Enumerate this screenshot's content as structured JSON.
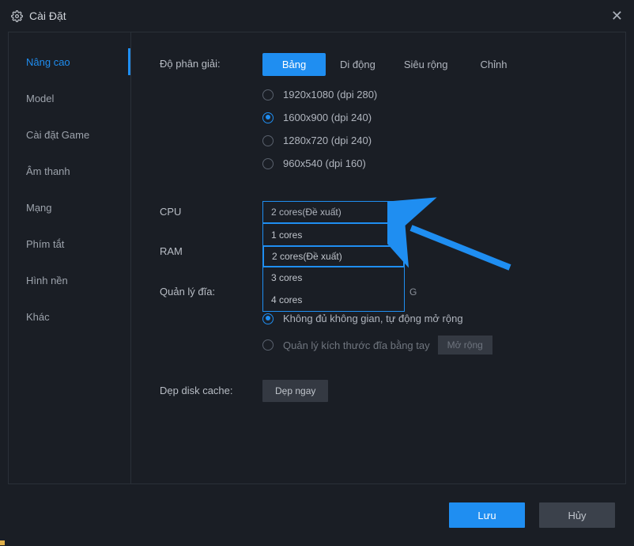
{
  "window": {
    "title": "Cài Đặt"
  },
  "sidebar": {
    "items": [
      {
        "label": "Nâng cao",
        "active": true
      },
      {
        "label": "Model",
        "active": false
      },
      {
        "label": "Cài đặt Game",
        "active": false
      },
      {
        "label": "Âm thanh",
        "active": false
      },
      {
        "label": "Mạng",
        "active": false
      },
      {
        "label": "Phím tắt",
        "active": false
      },
      {
        "label": "Hình nền",
        "active": false
      },
      {
        "label": "Khác",
        "active": false
      }
    ]
  },
  "resolution": {
    "label": "Độ phân giải:",
    "tabs": [
      {
        "label": "Bảng",
        "active": true
      },
      {
        "label": "Di động",
        "active": false
      },
      {
        "label": "Siêu rộng",
        "active": false
      },
      {
        "label": "Chỉnh",
        "active": false
      }
    ],
    "options": [
      {
        "label": "1920x1080  (dpi 280)",
        "selected": false
      },
      {
        "label": "1600x900  (dpi 240)",
        "selected": true
      },
      {
        "label": "1280x720  (dpi 240)",
        "selected": false
      },
      {
        "label": "960x540  (dpi 160)",
        "selected": false
      }
    ]
  },
  "cpu": {
    "label": "CPU",
    "selected": "2 cores(Đề xuất)",
    "options": [
      "1 cores",
      "2 cores(Đề xuất)",
      "3 cores",
      "4 cores"
    ],
    "highlight_index": 1
  },
  "ram": {
    "label": "RAM"
  },
  "disk": {
    "label": "Quản lý đĩa:",
    "trailing": "G",
    "options": [
      {
        "label": "Không đủ không gian, tự động mở rộng",
        "selected": true,
        "disabled": false
      },
      {
        "label": "Quản lý kích thước đĩa bằng tay",
        "selected": false,
        "disabled": true
      }
    ],
    "expand_btn": "Mở rộng"
  },
  "cache": {
    "label": "Dẹp disk cache:",
    "button": "Dẹp ngay"
  },
  "footer": {
    "save": "Lưu",
    "cancel": "Hủy"
  }
}
